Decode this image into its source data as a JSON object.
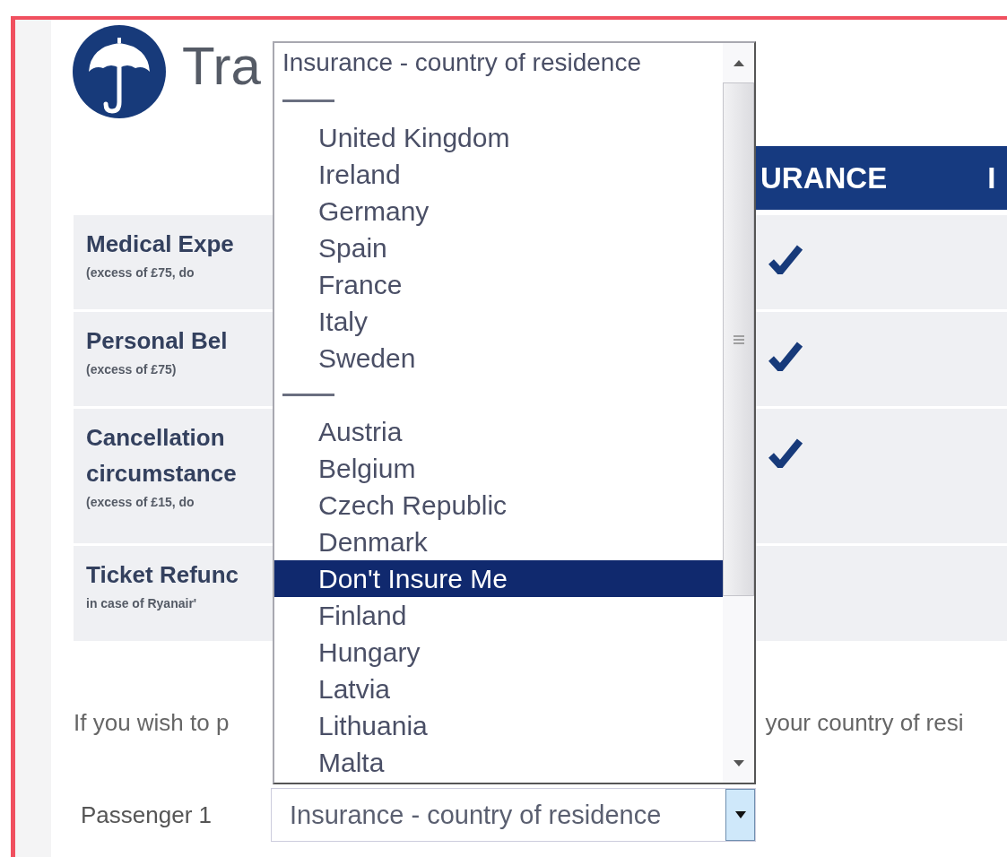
{
  "logo": {
    "title": "Tra"
  },
  "coverage_table": {
    "header": [
      "URANCE",
      "I"
    ],
    "rows": [
      {
        "title": "Medical Expe",
        "note": "(excess of £75, do",
        "covered": true
      },
      {
        "title": "Personal Bel",
        "note": "(excess of £75)",
        "covered": true
      },
      {
        "title": "Cancellation circumstance",
        "note": "(excess of £15, do",
        "covered": true
      },
      {
        "title": "Ticket Refunc",
        "note": "in case of Ryanair'",
        "covered": false
      }
    ]
  },
  "notice": [
    "If you wish to p",
    "your country of resi"
  ],
  "passengers": [
    {
      "label": "Passenger 1",
      "value": "Insurance - country of residence"
    }
  ],
  "dropdown": {
    "items": [
      {
        "kind": "heading",
        "label": "Insurance - country of residence",
        "selected": false
      },
      {
        "kind": "separator"
      },
      {
        "kind": "option",
        "label": "United Kingdom",
        "selected": false
      },
      {
        "kind": "option",
        "label": "Ireland",
        "selected": false
      },
      {
        "kind": "option",
        "label": "Germany",
        "selected": false
      },
      {
        "kind": "option",
        "label": "Spain",
        "selected": false
      },
      {
        "kind": "option",
        "label": "France",
        "selected": false
      },
      {
        "kind": "option",
        "label": "Italy",
        "selected": false
      },
      {
        "kind": "option",
        "label": "Sweden",
        "selected": false
      },
      {
        "kind": "separator"
      },
      {
        "kind": "option",
        "label": "Austria",
        "selected": false
      },
      {
        "kind": "option",
        "label": "Belgium",
        "selected": false
      },
      {
        "kind": "option",
        "label": "Czech Republic",
        "selected": false
      },
      {
        "kind": "option",
        "label": "Denmark",
        "selected": false
      },
      {
        "kind": "option",
        "label": "Don't Insure Me",
        "selected": true
      },
      {
        "kind": "option",
        "label": "Finland",
        "selected": false
      },
      {
        "kind": "option",
        "label": "Hungary",
        "selected": false
      },
      {
        "kind": "option",
        "label": "Latvia",
        "selected": false
      },
      {
        "kind": "option",
        "label": "Lithuania",
        "selected": false
      },
      {
        "kind": "option",
        "label": "Malta",
        "selected": false
      }
    ]
  }
}
